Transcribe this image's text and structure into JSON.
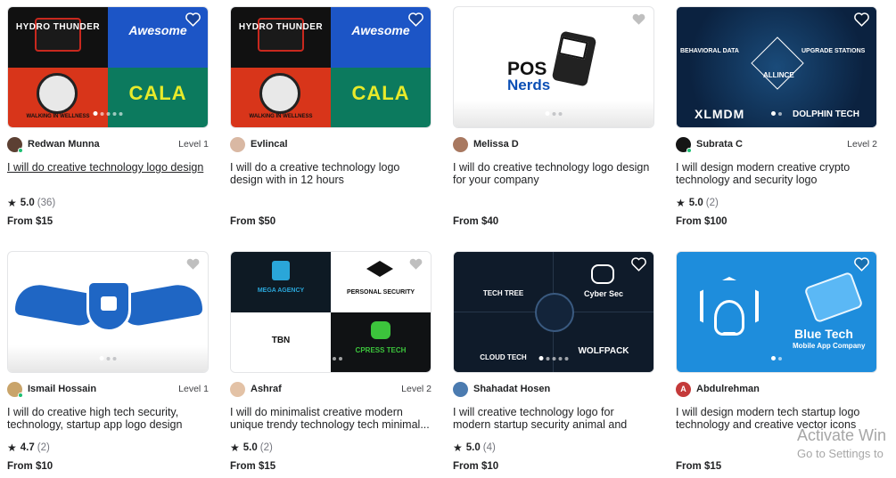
{
  "colors": {
    "accent_green": "#1dbf73",
    "text_dark": "#222325",
    "muted": "#74767e"
  },
  "gigs": [
    {
      "image": {
        "type": "quad",
        "labels": [
          "HYDRO THUNDER",
          "Awesome",
          "WALKING IN WELLNESS",
          "CALA"
        ]
      },
      "seller": "Redwan Munna",
      "level": "Level 1",
      "title": "I will do creative technology logo design",
      "rating": "5.0",
      "reviews": "(36)",
      "price": "From $15",
      "heart_icon": "heart-outline-icon"
    },
    {
      "image": {
        "type": "quad",
        "labels": [
          "HYDRO THUNDER",
          "Awesome",
          "WALKING IN WELLNESS",
          "CALA"
        ]
      },
      "seller": "Evlincal",
      "level": "",
      "title": "I will do a creative technology logo design with in 12 hours",
      "rating": "",
      "reviews": "",
      "price": "From $50",
      "heart_icon": "heart-outline-icon"
    },
    {
      "image": {
        "type": "pos",
        "labels": [
          "POS",
          "Nerds"
        ]
      },
      "seller": "Melissa D",
      "level": "",
      "title": "I will do creative technology logo design for your company",
      "rating": "",
      "reviews": "",
      "price": "From $40",
      "heart_icon": "heart-outline-icon"
    },
    {
      "image": {
        "type": "crypto",
        "labels": [
          "BEHAVIORAL DATA",
          "UPGRADE STATIONS",
          "ALLINCE",
          "XLMDM",
          "DOLPHIN TECH"
        ]
      },
      "seller": "Subrata C",
      "level": "Level 2",
      "title": "I will design modern creative crypto technology and security logo",
      "rating": "5.0",
      "reviews": "(2)",
      "price": "From $100",
      "heart_icon": "heart-outline-icon"
    },
    {
      "image": {
        "type": "wings",
        "labels": []
      },
      "seller": "Ismail Hossain",
      "level": "Level 1",
      "title": "I will do creative high tech security, technology, startup app logo design",
      "rating": "4.7",
      "reviews": "(2)",
      "price": "From $10",
      "heart_icon": "heart-outline-icon"
    },
    {
      "image": {
        "type": "quad2",
        "labels": [
          "MEGA AGENCY",
          "PERSONAL SECURITY",
          "TBN",
          "CPRESS TECH"
        ]
      },
      "seller": "Ashraf",
      "level": "Level 2",
      "title": "I will do minimalist creative modern unique trendy technology tech minimal...",
      "rating": "5.0",
      "reviews": "(2)",
      "price": "From $15",
      "heart_icon": "heart-outline-icon"
    },
    {
      "image": {
        "type": "quad3",
        "labels": [
          "TECH TREE",
          "Cyber Sec",
          "CLOUD TECH",
          "WOLFPACK"
        ]
      },
      "seller": "Shahadat Hosen",
      "level": "",
      "title": "I will creative technology logo for modern startup security animal and crypto design",
      "rating": "5.0",
      "reviews": "(4)",
      "price": "From $10",
      "heart_icon": "heart-outline-icon"
    },
    {
      "image": {
        "type": "bluetech",
        "labels": [
          "Blue Tech",
          "Mobile App Company"
        ]
      },
      "seller": "Abdulrehman",
      "level": "",
      "title": "I will design modern tech startup logo technology and creative vector icons",
      "rating": "",
      "reviews": "",
      "price": "From $15",
      "heart_icon": "heart-outline-icon"
    }
  ],
  "watermark": {
    "line1": "Activate Win",
    "line2": "Go to Settings to"
  }
}
